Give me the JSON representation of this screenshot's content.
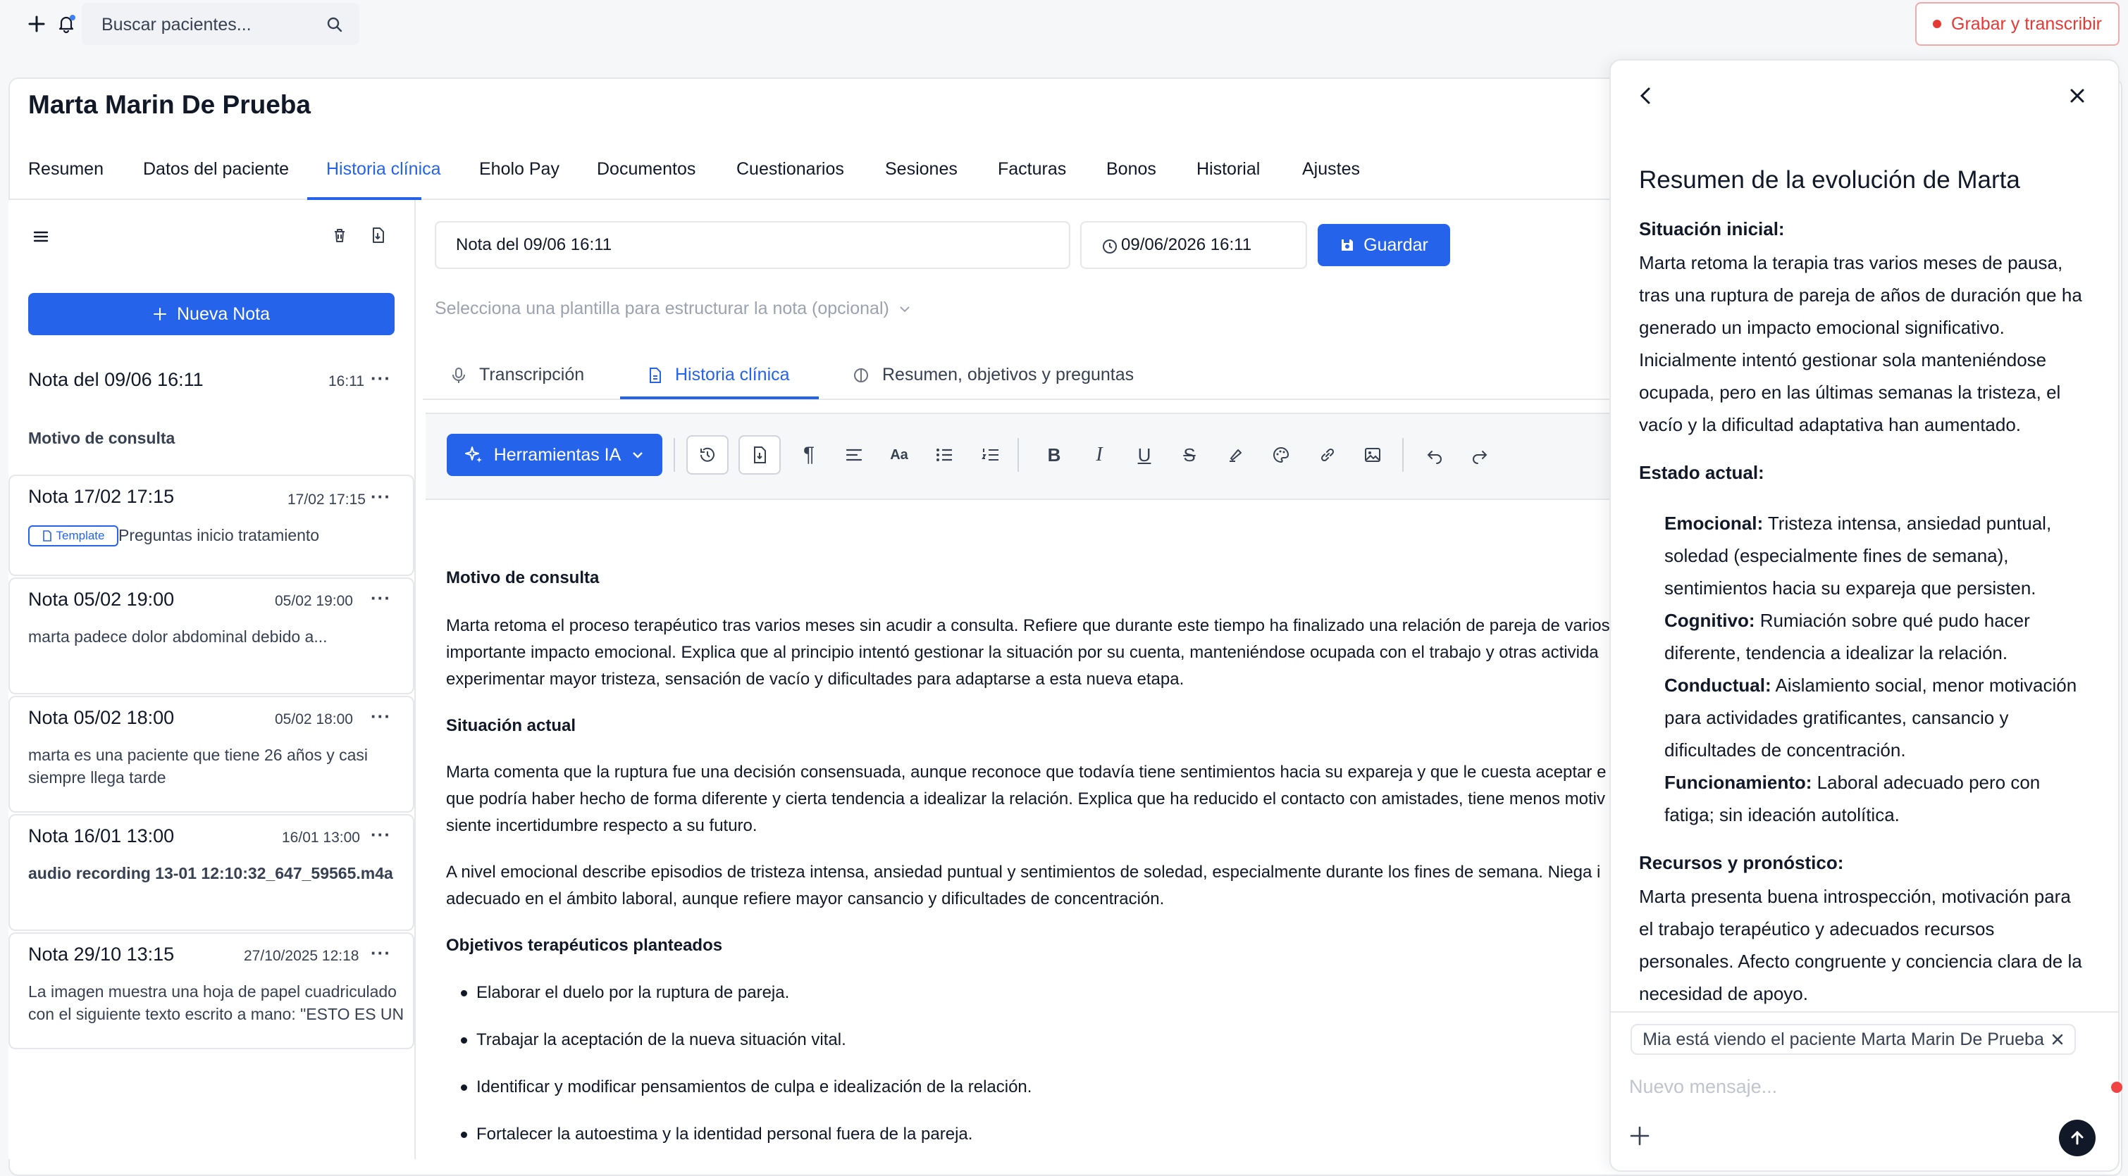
{
  "search": {
    "placeholder": "Buscar pacientes..."
  },
  "record_button": {
    "label": "Grabar y transcribir"
  },
  "patient": {
    "name": "Marta Marin De Prueba"
  },
  "tabs": [
    "Resumen",
    "Datos del paciente",
    "Historia clínica",
    "Eholo Pay",
    "Documentos",
    "Cuestionarios",
    "Sesiones",
    "Facturas",
    "Bonos",
    "Historial",
    "Ajustes"
  ],
  "active_tab": "Historia clínica",
  "sidebar": {
    "new_note": "Nueva Nota",
    "notes": [
      {
        "title": "Nota del 09/06 16:11",
        "time": "16:11",
        "preview": "Motivo de consulta"
      },
      {
        "title": "Nota 17/02 17:15",
        "time": "17/02 17:15",
        "badge": "Template",
        "preview": "Preguntas inicio tratamiento"
      },
      {
        "title": "Nota 05/02 19:00",
        "time": "05/02 19:00",
        "preview": "marta padece dolor abdominal debido a..."
      },
      {
        "title": "Nota 05/02 18:00",
        "time": "05/02 18:00",
        "preview": "marta es una paciente que tiene 26 años y casi siempre llega tarde"
      },
      {
        "title": "Nota 16/01 13:00",
        "time": "16/01 13:00",
        "preview": "audio recording 13-01 12:10:32_647_59565.m4a"
      },
      {
        "title": "Nota 29/10 13:15",
        "time": "27/10/2025 12:18",
        "preview": "La imagen muestra una hoja de papel cuadriculado con el siguiente texto escrito a mano: \"ESTO ES UN"
      }
    ]
  },
  "editor": {
    "note_title": "Nota del 09/06 16:11",
    "datetime": "09/06/2026 16:11",
    "save": "Guardar",
    "template_placeholder": "Selecciona una plantilla para estructurar la nota (opcional)",
    "subtabs": [
      "Transcripción",
      "Historia clínica",
      "Resumen, objetivos y preguntas"
    ],
    "ai_tools": "Herramientas IA",
    "content": {
      "h1": "Motivo de consulta",
      "p1": [
        "Marta retoma el proceso terapéutico tras varios meses sin acudir a consulta. Refiere que durante este tiempo ha finalizado una relación de pareja de varios",
        "importante impacto emocional. Explica que al principio intentó gestionar la situación por su cuenta, manteniéndose ocupada con el trabajo y otras activida",
        "experimentar mayor tristeza, sensación de vacío y dificultades para adaptarse a esta nueva etapa."
      ],
      "h2": "Situación actual",
      "p2": [
        "Marta comenta que la ruptura fue una decisión consensuada, aunque reconoce que todavía tiene sentimientos hacia su expareja y que le cuesta aceptar e",
        "que podría haber hecho de forma diferente y cierta tendencia a idealizar la relación. Explica que ha reducido el contacto con amistades, tiene menos motiv",
        "siente incertidumbre respecto a su futuro."
      ],
      "p3": [
        "A nivel emocional describe episodios de tristeza intensa, ansiedad puntual y sentimientos de soledad, especialmente durante los fines de semana. Niega i",
        "adecuado en el ámbito laboral, aunque refiere mayor cansancio y dificultades de concentración."
      ],
      "h3": "Objetivos terapéuticos planteados",
      "bullets": [
        "Elaborar el duelo por la ruptura de pareja.",
        "Trabajar la aceptación de la nueva situación vital.",
        "Identificar y modificar pensamientos de culpa e idealización de la relación.",
        "Fortalecer la autoestima y la identidad personal fuera de la pareja."
      ]
    }
  },
  "panel": {
    "title": "Resumen de la evolución de Marta",
    "initial_head": "Situación inicial:",
    "initial_lines": [
      "Marta retoma la terapia tras varios meses de pausa,",
      "tras una ruptura de pareja de años de duración que ha",
      "generado un impacto emocional significativo.",
      "Inicialmente intentó gestionar sola manteniéndose",
      "ocupada, pero en las últimas semanas la tristeza, el",
      "vacío y la dificultad adaptativa han aumentado."
    ],
    "current_head": "Estado actual:",
    "emotional_label": "Emocional:",
    "emotional_lines": [
      " Tristeza intensa, ansiedad puntual,",
      "soledad (especialmente fines de semana),",
      "sentimientos hacia su expareja que persisten."
    ],
    "cognitive_label": "Cognitivo:",
    "cognitive_lines": [
      " Rumiación sobre qué pudo hacer",
      "diferente, tendencia a idealizar la relación."
    ],
    "behavioral_label": "Conductual:",
    "behavioral_lines": [
      " Aislamiento social, menor motivación",
      "para actividades gratificantes, cansancio y",
      "dificultades de concentración."
    ],
    "functioning_label": "Funcionamiento:",
    "functioning_lines": [
      " Laboral adecuado pero con",
      "fatiga; sin ideación autolítica."
    ],
    "resources_head": "Recursos y pronóstico:",
    "resources_lines": [
      "Marta presenta buena introspección, motivación para",
      "el trabajo terapéutico y adecuados recursos",
      "personales. Afecto congruente y conciencia clara de la",
      "necesidad de apoyo."
    ],
    "context_chip": "Mia está viendo el paciente Marta Marin De Prueba",
    "message_placeholder": "Nuevo mensaje..."
  },
  "colors": {
    "accent": "#2563eb",
    "record": "#e53935"
  }
}
